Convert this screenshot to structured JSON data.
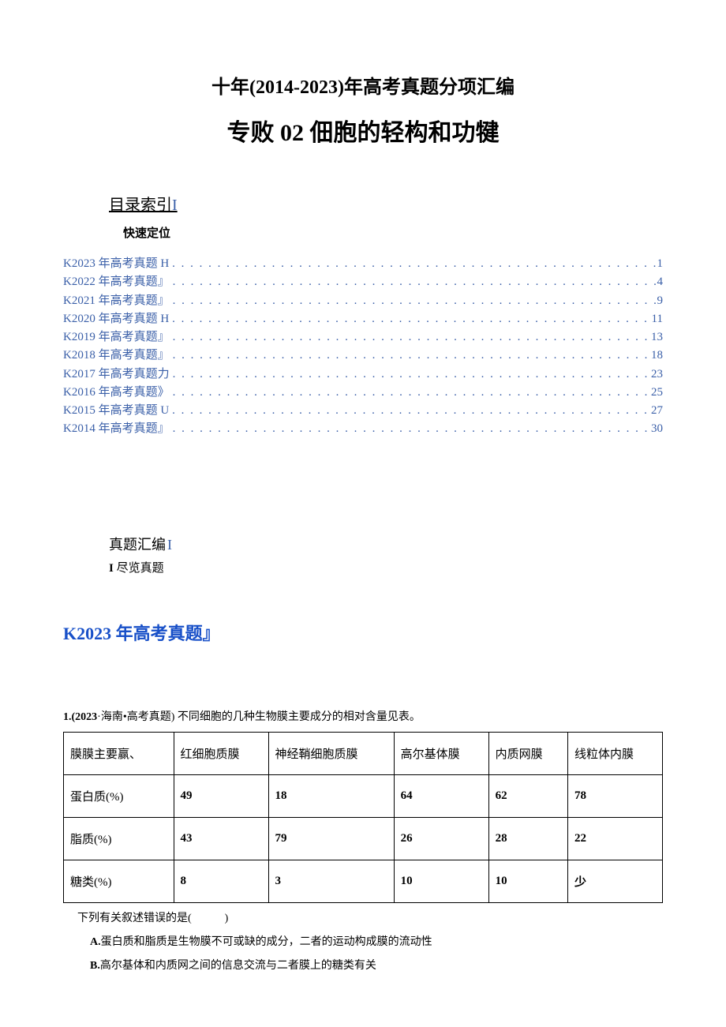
{
  "header": {
    "title1": "十年(2014-2023)年高考真题分项汇编",
    "title2": "专败 02 佃胞的轻构和功犍"
  },
  "toc": {
    "section_label": "目录索引",
    "section_bar": "I",
    "sub_label": "快速定位",
    "items": [
      {
        "label": "K2023 年高考真题 H",
        "page": "1"
      },
      {
        "label": "K2022 年高考真题』",
        "page": "4"
      },
      {
        "label": "K2021 年高考真题』",
        "page": "9"
      },
      {
        "label": "K2020 年高考真题 H",
        "page": "11"
      },
      {
        "label": "K2019 年高考真题』",
        "page": "13"
      },
      {
        "label": "K2018 年高考真题』",
        "page": "18"
      },
      {
        "label": "K2017 年高考真题力",
        "page": "23"
      },
      {
        "label": "K2016 年高考真题》",
        "page": "25"
      },
      {
        "label": "K2015 年高考真题 U",
        "page": "27"
      },
      {
        "label": "K2014 年高考真题』",
        "page": "30"
      }
    ]
  },
  "compile": {
    "label": "真题汇编",
    "bar": "I",
    "sub_eye": "I",
    "sub_text": " 尽览真题"
  },
  "year_heading": "K2023 年高考真题』",
  "question": {
    "num": "1.(2023",
    "intro_rest": "·海南•高考真题) 不同细胞的几种生物膜主要成分的相对含量见表。",
    "table": {
      "headers": [
        "膜膜主要赢、",
        "红细胞质膜",
        "神经鞘细胞质膜",
        "高尔基体膜",
        "内质网膜",
        "线粒体内膜"
      ],
      "rows": [
        {
          "label": "蛋白质(%)",
          "cells": [
            "49",
            "18",
            "64",
            "62",
            "78"
          ]
        },
        {
          "label": "脂质(%)",
          "cells": [
            "43",
            "79",
            "26",
            "28",
            "22"
          ]
        },
        {
          "label": "糖类(%)",
          "cells": [
            "8",
            "3",
            "10",
            "10",
            "少"
          ]
        }
      ]
    },
    "follow": "下列有关叙述错误的是(　　　)",
    "options": [
      {
        "letter": "A.",
        "text": "蛋白质和脂质是生物膜不可或缺的成分，二者的运动构成膜的流动性"
      },
      {
        "letter": "B.",
        "text": "高尔基体和内质网之间的信息交流与二者膜上的糖类有关"
      }
    ]
  }
}
